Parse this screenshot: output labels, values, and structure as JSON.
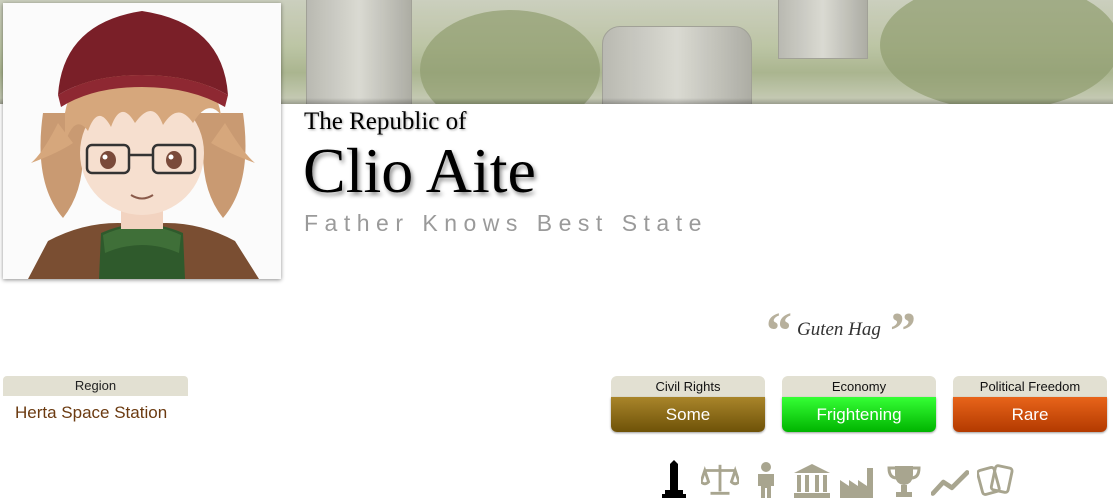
{
  "nation": {
    "pretitle": "The Republic of",
    "name": "Clio Aite",
    "classification": "Father Knows Best State",
    "motto": "Guten Hag",
    "open_quote": "“",
    "close_quote": "”"
  },
  "region": {
    "label": "Region",
    "name": "Herta Space Station"
  },
  "stats": [
    {
      "label": "Civil Rights",
      "value": "Some",
      "color_top": "#a9852a",
      "color_bottom": "#6e5208"
    },
    {
      "label": "Economy",
      "value": "Frightening",
      "color_top": "#35ff35",
      "color_bottom": "#00b400"
    },
    {
      "label": "Political Freedom",
      "value": "Rare",
      "color_top": "#e8641a",
      "color_bottom": "#b33a00"
    }
  ],
  "icons": [
    "overview-icon",
    "government-icon",
    "people-icon",
    "rank-icon",
    "economy-icon",
    "trophy-icon",
    "trend-icon",
    "cards-icon"
  ],
  "colors": {
    "icon_active": "#000000",
    "icon_inactive": "#a8a58f",
    "region_link": "#6b3a10"
  }
}
